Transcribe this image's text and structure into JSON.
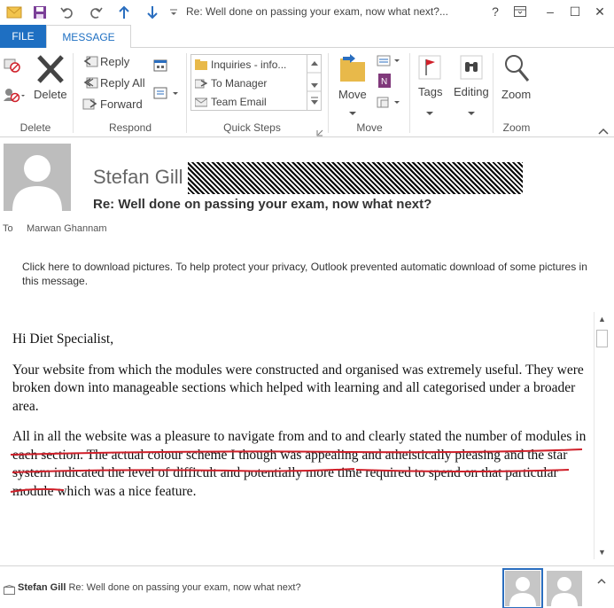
{
  "window": {
    "title": "Re: Well done on passing your exam, now what next?...",
    "help": "?",
    "minimize": "–",
    "maximize": "☐",
    "close": "✕"
  },
  "tabs": [
    {
      "label": "FILE"
    },
    {
      "label": "MESSAGE"
    }
  ],
  "ribbon": {
    "delete": {
      "delete_label": "Delete",
      "group": "Delete"
    },
    "respond": {
      "reply": "Reply",
      "reply_all": "Reply All",
      "forward": "Forward",
      "group": "Respond"
    },
    "quick_steps": {
      "items": [
        "Inquiries - info...",
        "To Manager",
        "Team Email"
      ],
      "group": "Quick Steps"
    },
    "move": {
      "move_label": "Move",
      "group": "Move"
    },
    "tags": {
      "label": "Tags"
    },
    "editing": {
      "label": "Editing"
    },
    "zoom": {
      "label": "Zoom",
      "group": "Zoom"
    }
  },
  "header": {
    "sender": "Stefan Gill",
    "subject": "Re: Well done on passing your exam, now what next?",
    "to_label": "To",
    "to_name": "Marwan Ghannam",
    "info": "Click here to download pictures. To help protect your privacy, Outlook prevented automatic download of some pictures in this message."
  },
  "message": {
    "greeting": "Hi Diet Specialist,",
    "p1": "Your website from which the modules were constructed and organised was extremely useful. They were broken down into manageable sections which helped with learning and all categorised under a broader area.",
    "p2": "All in all the website was a pleasure to navigate from and to and clearly stated the number of modules in each section. The actual colour scheme I though was appealing and atheistically pleasing and the star system indicated the level of difficult and potentially more time required to spend on that particular module which was a nice feature."
  },
  "people_pane": {
    "sender": "Stefan Gill",
    "subject": "Re: Well done on passing your exam, now what next?"
  },
  "colors": {
    "accent": "#1e6fc2",
    "annotation": "#d0202a"
  }
}
